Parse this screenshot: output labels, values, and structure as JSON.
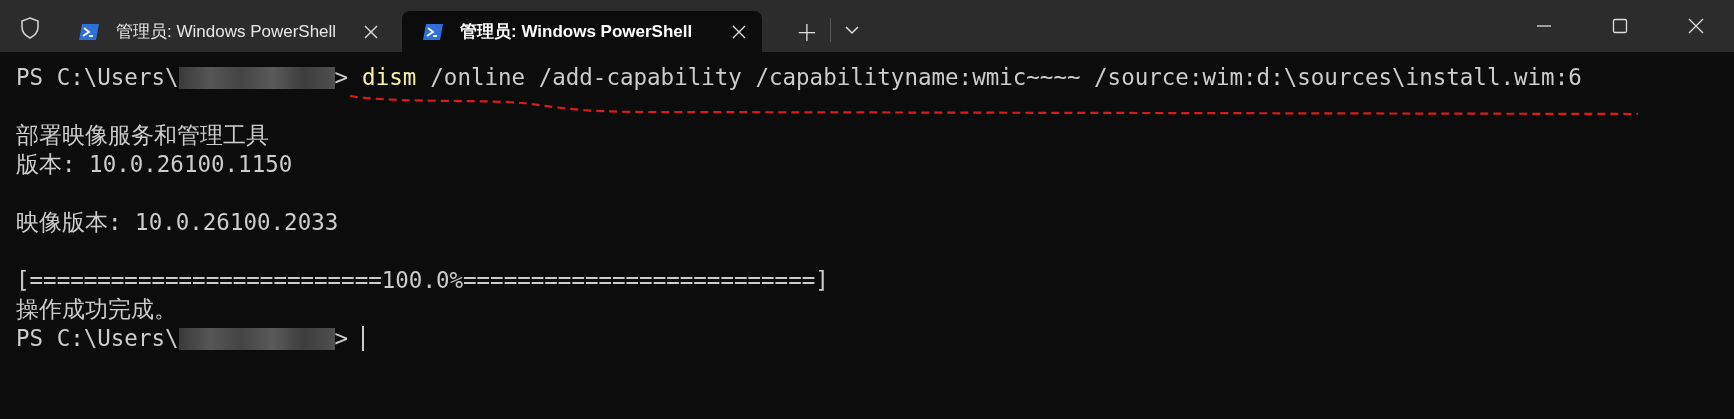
{
  "tabs": [
    {
      "title": "管理员: Windows PowerShell",
      "selected": false
    },
    {
      "title": "管理员: Windows PowerShell",
      "selected": true
    }
  ],
  "new_tab": "+",
  "lines": [
    {
      "kind": "prompt",
      "prompt": "PS C:\\Users\\",
      "suffix": ">",
      "command": "dism",
      "args": "/online /add-capability /capabilityname:wmic~~~~ /source:wim:d:\\sources\\install.wim:6",
      "cursor": false
    },
    {
      "kind": "blank"
    },
    {
      "kind": "text",
      "text": "部署映像服务和管理工具"
    },
    {
      "kind": "text",
      "text": "版本: 10.0.26100.1150"
    },
    {
      "kind": "blank"
    },
    {
      "kind": "text",
      "text": "映像版本: 10.0.26100.2033"
    },
    {
      "kind": "blank"
    },
    {
      "kind": "text",
      "text": "[==========================100.0%==========================]"
    },
    {
      "kind": "text",
      "text": "操作成功完成。"
    },
    {
      "kind": "prompt",
      "prompt": "PS C:\\Users\\",
      "suffix": ">",
      "cursor": true
    }
  ]
}
